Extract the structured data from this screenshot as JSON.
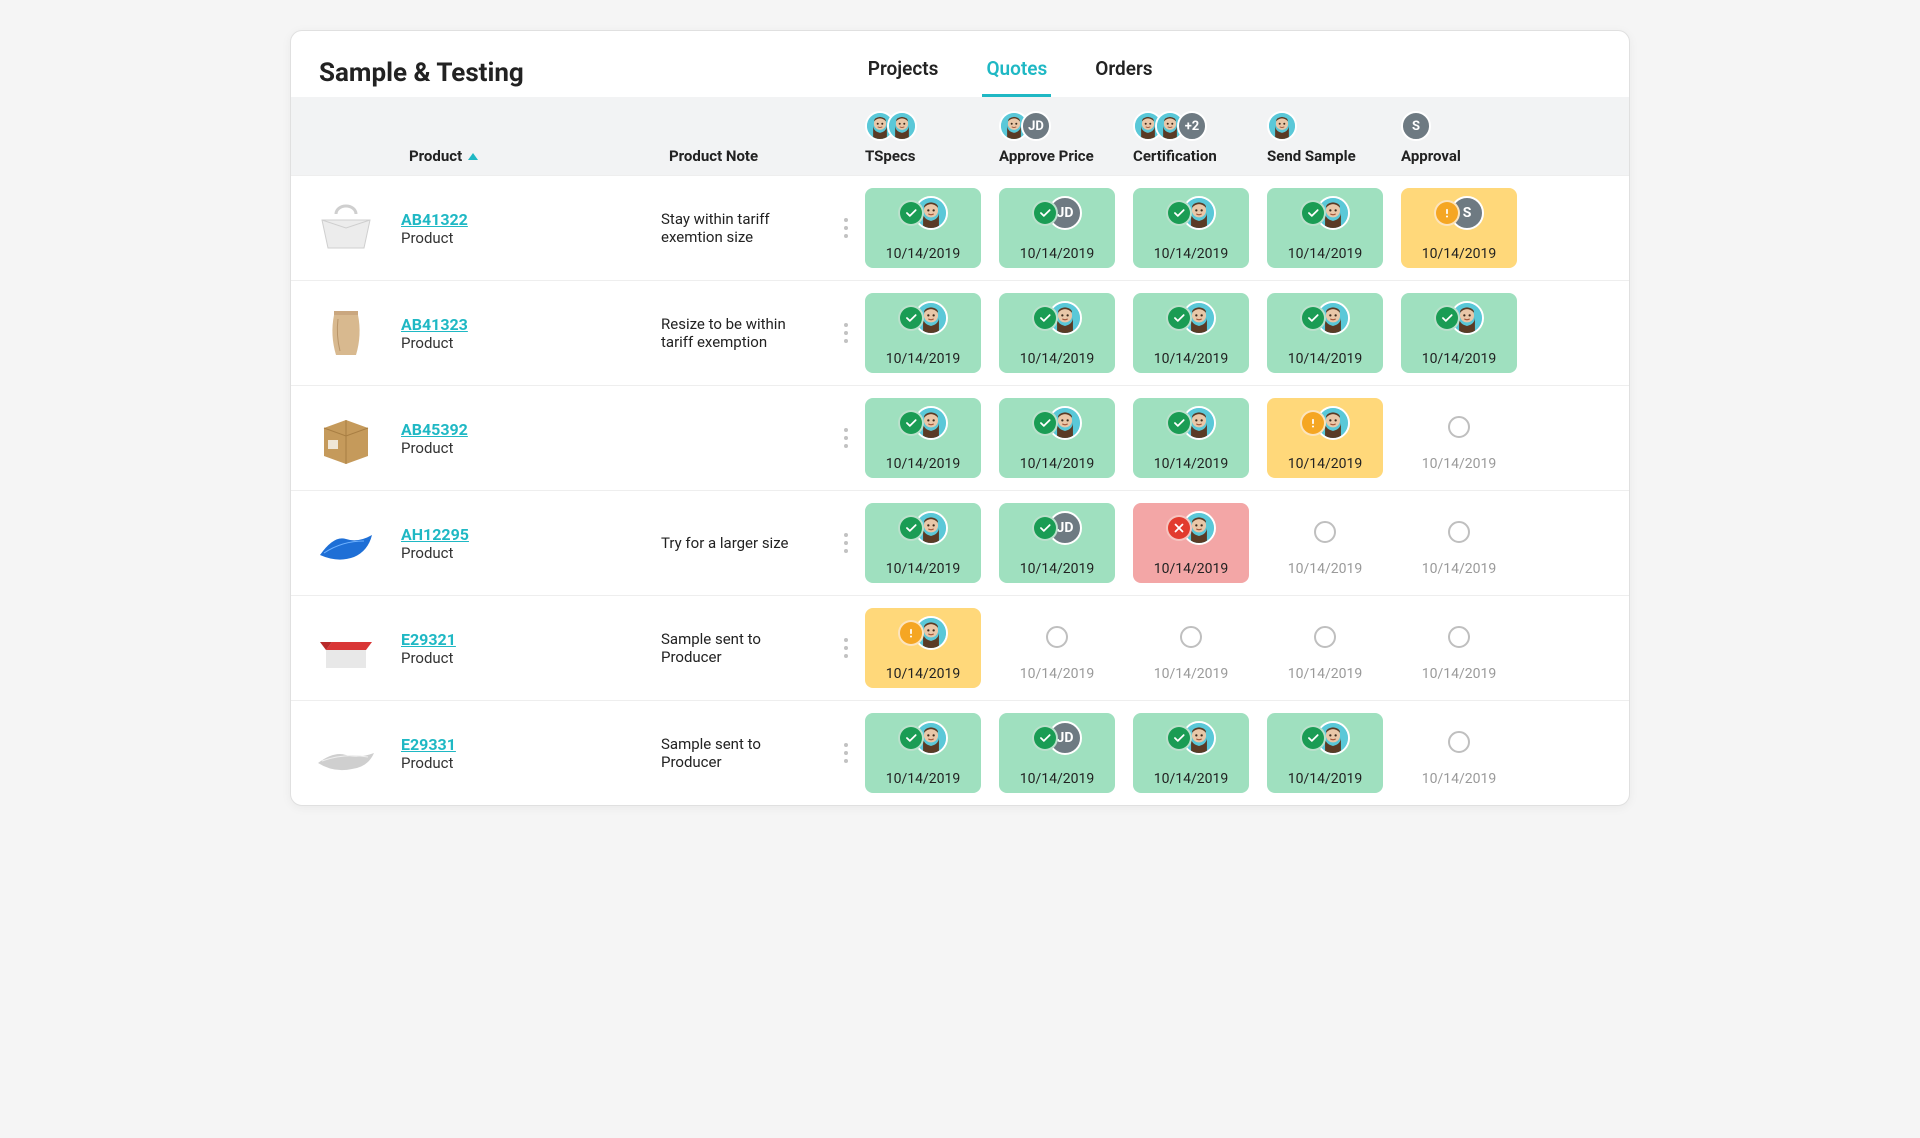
{
  "title": "Sample & Testing",
  "tabs": [
    {
      "label": "Projects",
      "active": false
    },
    {
      "label": "Quotes",
      "active": true
    },
    {
      "label": "Orders",
      "active": false
    }
  ],
  "columns": {
    "product": "Product",
    "note": "Product Note"
  },
  "stages": [
    {
      "label": "TSpecs",
      "avatars": [
        {
          "t": "photo"
        },
        {
          "t": "photo"
        }
      ]
    },
    {
      "label": "Approve Price",
      "avatars": [
        {
          "t": "photo"
        },
        {
          "t": "initials",
          "v": "JD"
        }
      ]
    },
    {
      "label": "Certification",
      "avatars": [
        {
          "t": "photo"
        },
        {
          "t": "photo"
        },
        {
          "t": "count",
          "v": "+2"
        }
      ]
    },
    {
      "label": "Send Sample",
      "avatars": [
        {
          "t": "photo"
        }
      ]
    },
    {
      "label": "Approval",
      "avatars": [
        {
          "t": "initials",
          "v": "S"
        }
      ]
    }
  ],
  "rows": [
    {
      "sku": "AB41322",
      "sub": "Product",
      "note": "Stay within tariff exemtion size",
      "thumb": "box-handle",
      "cells": [
        {
          "status": "ok",
          "date": "10/14/2019",
          "who": [
            {
              "t": "photo"
            }
          ]
        },
        {
          "status": "ok",
          "date": "10/14/2019",
          "who": [
            {
              "t": "initials",
              "v": "JD"
            }
          ]
        },
        {
          "status": "ok",
          "date": "10/14/2019",
          "who": [
            {
              "t": "photo"
            }
          ]
        },
        {
          "status": "ok",
          "date": "10/14/2019",
          "who": [
            {
              "t": "photo"
            }
          ]
        },
        {
          "status": "warn",
          "date": "10/14/2019",
          "who": [
            {
              "t": "initials",
              "v": "S"
            }
          ]
        }
      ]
    },
    {
      "sku": "AB41323",
      "sub": "Product",
      "note": "Resize to be within tariff exemption",
      "thumb": "pouch",
      "cells": [
        {
          "status": "ok",
          "date": "10/14/2019",
          "who": [
            {
              "t": "photo"
            }
          ]
        },
        {
          "status": "ok",
          "date": "10/14/2019",
          "who": [
            {
              "t": "photo"
            }
          ]
        },
        {
          "status": "ok",
          "date": "10/14/2019",
          "who": [
            {
              "t": "photo"
            }
          ]
        },
        {
          "status": "ok",
          "date": "10/14/2019",
          "who": [
            {
              "t": "photo"
            }
          ]
        },
        {
          "status": "ok",
          "date": "10/14/2019",
          "who": [
            {
              "t": "photo"
            }
          ]
        }
      ]
    },
    {
      "sku": "AB45392",
      "sub": "Product",
      "note": "",
      "thumb": "carton",
      "cells": [
        {
          "status": "ok",
          "date": "10/14/2019",
          "who": [
            {
              "t": "photo"
            }
          ]
        },
        {
          "status": "ok",
          "date": "10/14/2019",
          "who": [
            {
              "t": "photo"
            }
          ]
        },
        {
          "status": "ok",
          "date": "10/14/2019",
          "who": [
            {
              "t": "photo"
            }
          ]
        },
        {
          "status": "warn",
          "date": "10/14/2019",
          "who": [
            {
              "t": "photo"
            }
          ]
        },
        {
          "status": "none",
          "date": "10/14/2019"
        }
      ]
    },
    {
      "sku": "AH12295",
      "sub": "Product",
      "note": "Try for a larger size",
      "thumb": "pillow-blue",
      "cells": [
        {
          "status": "ok",
          "date": "10/14/2019",
          "who": [
            {
              "t": "photo"
            }
          ]
        },
        {
          "status": "ok",
          "date": "10/14/2019",
          "who": [
            {
              "t": "initials",
              "v": "JD"
            }
          ]
        },
        {
          "status": "err",
          "date": "10/14/2019",
          "who": [
            {
              "t": "photo"
            }
          ]
        },
        {
          "status": "none",
          "date": "10/14/2019"
        },
        {
          "status": "none",
          "date": "10/14/2019"
        }
      ]
    },
    {
      "sku": "E29321",
      "sub": "Product",
      "note": "Sample sent to Producer",
      "thumb": "redbox",
      "cells": [
        {
          "status": "warn",
          "date": "10/14/2019",
          "who": [
            {
              "t": "photo"
            }
          ]
        },
        {
          "status": "none",
          "date": "10/14/2019"
        },
        {
          "status": "none",
          "date": "10/14/2019"
        },
        {
          "status": "none",
          "date": "10/14/2019"
        },
        {
          "status": "none",
          "date": "10/14/2019"
        }
      ]
    },
    {
      "sku": "E29331",
      "sub": "Product",
      "note": "Sample sent to Producer",
      "thumb": "pillow-silver",
      "cells": [
        {
          "status": "ok",
          "date": "10/14/2019",
          "who": [
            {
              "t": "photo"
            }
          ]
        },
        {
          "status": "ok",
          "date": "10/14/2019",
          "who": [
            {
              "t": "initials",
              "v": "JD"
            }
          ]
        },
        {
          "status": "ok",
          "date": "10/14/2019",
          "who": [
            {
              "t": "photo"
            }
          ]
        },
        {
          "status": "ok",
          "date": "10/14/2019",
          "who": [
            {
              "t": "photo"
            }
          ]
        },
        {
          "status": "none",
          "date": "10/14/2019"
        }
      ]
    }
  ]
}
